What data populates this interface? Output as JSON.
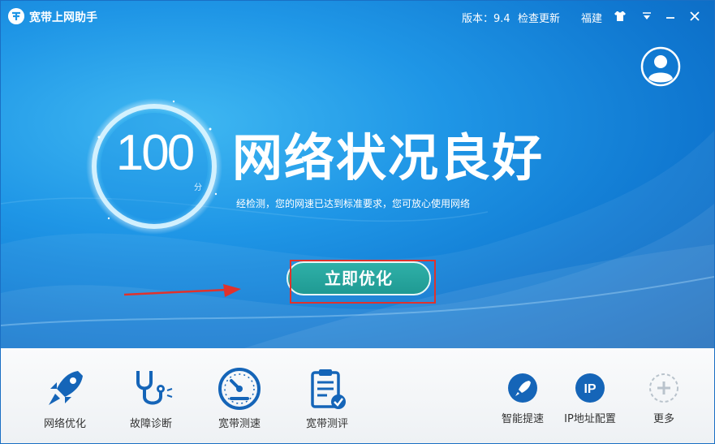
{
  "app": {
    "title": "宽带上网助手"
  },
  "titlebar": {
    "version": "版本：9.4",
    "check_update": "检查更新",
    "region": "福建",
    "icons": [
      "skin-icon",
      "menu-dropdown-icon",
      "minimize-icon",
      "close-icon"
    ]
  },
  "status": {
    "score": "100",
    "score_unit": "分",
    "headline": "网络状况良好",
    "description": "经检测，您的网速已达到标准要求，您可放心使用网络"
  },
  "actions": {
    "optimize_label": "立即优化"
  },
  "tools": [
    {
      "label": "网络优化",
      "icon": "rocket-icon"
    },
    {
      "label": "故障诊断",
      "icon": "stethoscope-icon"
    },
    {
      "label": "宽带测速",
      "icon": "speedometer-icon"
    },
    {
      "label": "宽带测评",
      "icon": "clipboard-check-icon"
    }
  ],
  "shortcuts": [
    {
      "label": "智能提速",
      "icon": "rocket-badge-icon",
      "glyph": ""
    },
    {
      "label": "IP地址配置",
      "icon": "ip-badge-icon",
      "glyph": "IP"
    },
    {
      "label": "更多",
      "icon": "plus-circle-icon",
      "glyph": ""
    }
  ],
  "colors": {
    "header_blue": "#1f96e6",
    "button_teal": "#2aa89f",
    "icon_blue": "#1565b8",
    "highlight_red": "#e0322c"
  }
}
